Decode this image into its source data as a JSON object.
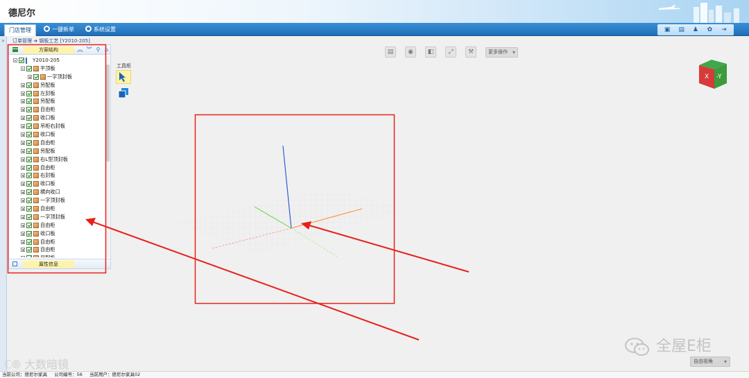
{
  "header": {
    "brand": "德尼尔"
  },
  "nav": {
    "tabs": [
      {
        "label": "门店管理",
        "active": true
      },
      {
        "label": "一键新单"
      },
      {
        "label": "系统设置"
      }
    ],
    "right_icons": [
      "screen-icon",
      "calendar-icon",
      "user-icon",
      "gear-icon",
      "logout-icon"
    ]
  },
  "breadcrumb": "订单管理 ➜ 钢板工艺 [Y2010-205]",
  "side_panel": {
    "title": "方案结构",
    "footer_title": "属性信息",
    "tree": {
      "root": "Y2010-205",
      "level1": "平顶板",
      "level2": "一字顶封板",
      "items": [
        "另配板",
        "左封板",
        "另配板",
        "自由柜",
        "收口板",
        "吊柜右封板",
        "收口板",
        "自由柜",
        "另配板",
        "右L型顶封板",
        "自由柜",
        "右封板",
        "收口板",
        "横向收口",
        "一字顶封板",
        "自由柜",
        "一字顶封板",
        "自由柜",
        "收口板",
        "自由柜",
        "自由柜",
        "另配板"
      ]
    }
  },
  "toolbar": {
    "buttons": [
      "save-icon",
      "target-icon",
      "layer-icon",
      "fit-icon",
      "tools-icon"
    ],
    "more_label": "更多操作"
  },
  "tool_cabinet": {
    "title": "工具柜"
  },
  "view_cube": {
    "x_label": "X",
    "y_label": "-Y"
  },
  "viewmode": {
    "selected": "自由视角"
  },
  "watermark": {
    "text": "全屋E柜",
    "text2": "大数暗镜"
  },
  "status": {
    "company": "当前公司：德尼尔家具",
    "company_no": "公司编号：56",
    "user": "当前用户：德尼尔家具02"
  },
  "colors": {
    "accent": "#1f6fb8",
    "annotation": "#e8201a",
    "axis_z": "#2d5bd8",
    "axis_x": "#ff8c2a",
    "axis_y": "#5dd33c"
  }
}
